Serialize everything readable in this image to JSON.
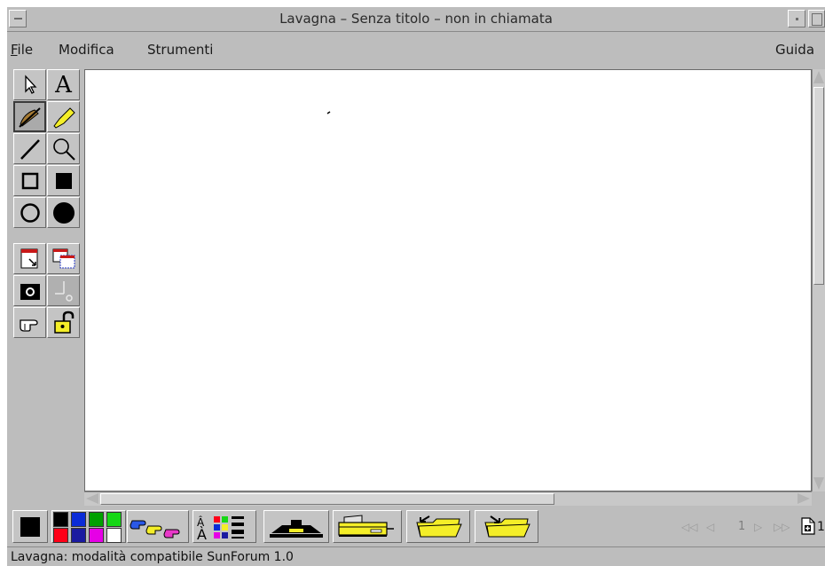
{
  "window": {
    "title": "Lavagna – Senza titolo  – non in chiamata"
  },
  "menubar": {
    "file": "File",
    "file_mnemonic": "F",
    "file_rest": "ile",
    "modifica": "Modifica",
    "strumenti": "Strumenti",
    "guida": "Guida"
  },
  "toolbox": {
    "text_tool_glyph": "A",
    "tools": [
      "select-arrow",
      "text",
      "pen",
      "highlighter",
      "line",
      "zoom",
      "rectangle-outline",
      "rectangle-filled",
      "ellipse-outline",
      "ellipse-filled",
      "import-page",
      "copy-page",
      "camera",
      "pointer-grid",
      "pointing-hand",
      "lock"
    ]
  },
  "colors": {
    "palette": [
      "#000000",
      "#0a2bd6",
      "#00a000",
      "#16d816",
      "#ff0018",
      "#1a1aa0",
      "#e600e6",
      "#ffffff"
    ],
    "current": "#000000",
    "highlighter": "#f4ee28",
    "folder": "#f4ee28"
  },
  "page_nav": {
    "current_page": "1",
    "total_pages": "1"
  },
  "status": {
    "text": "Lavagna: modalità compatibile SunForum 1.0"
  }
}
